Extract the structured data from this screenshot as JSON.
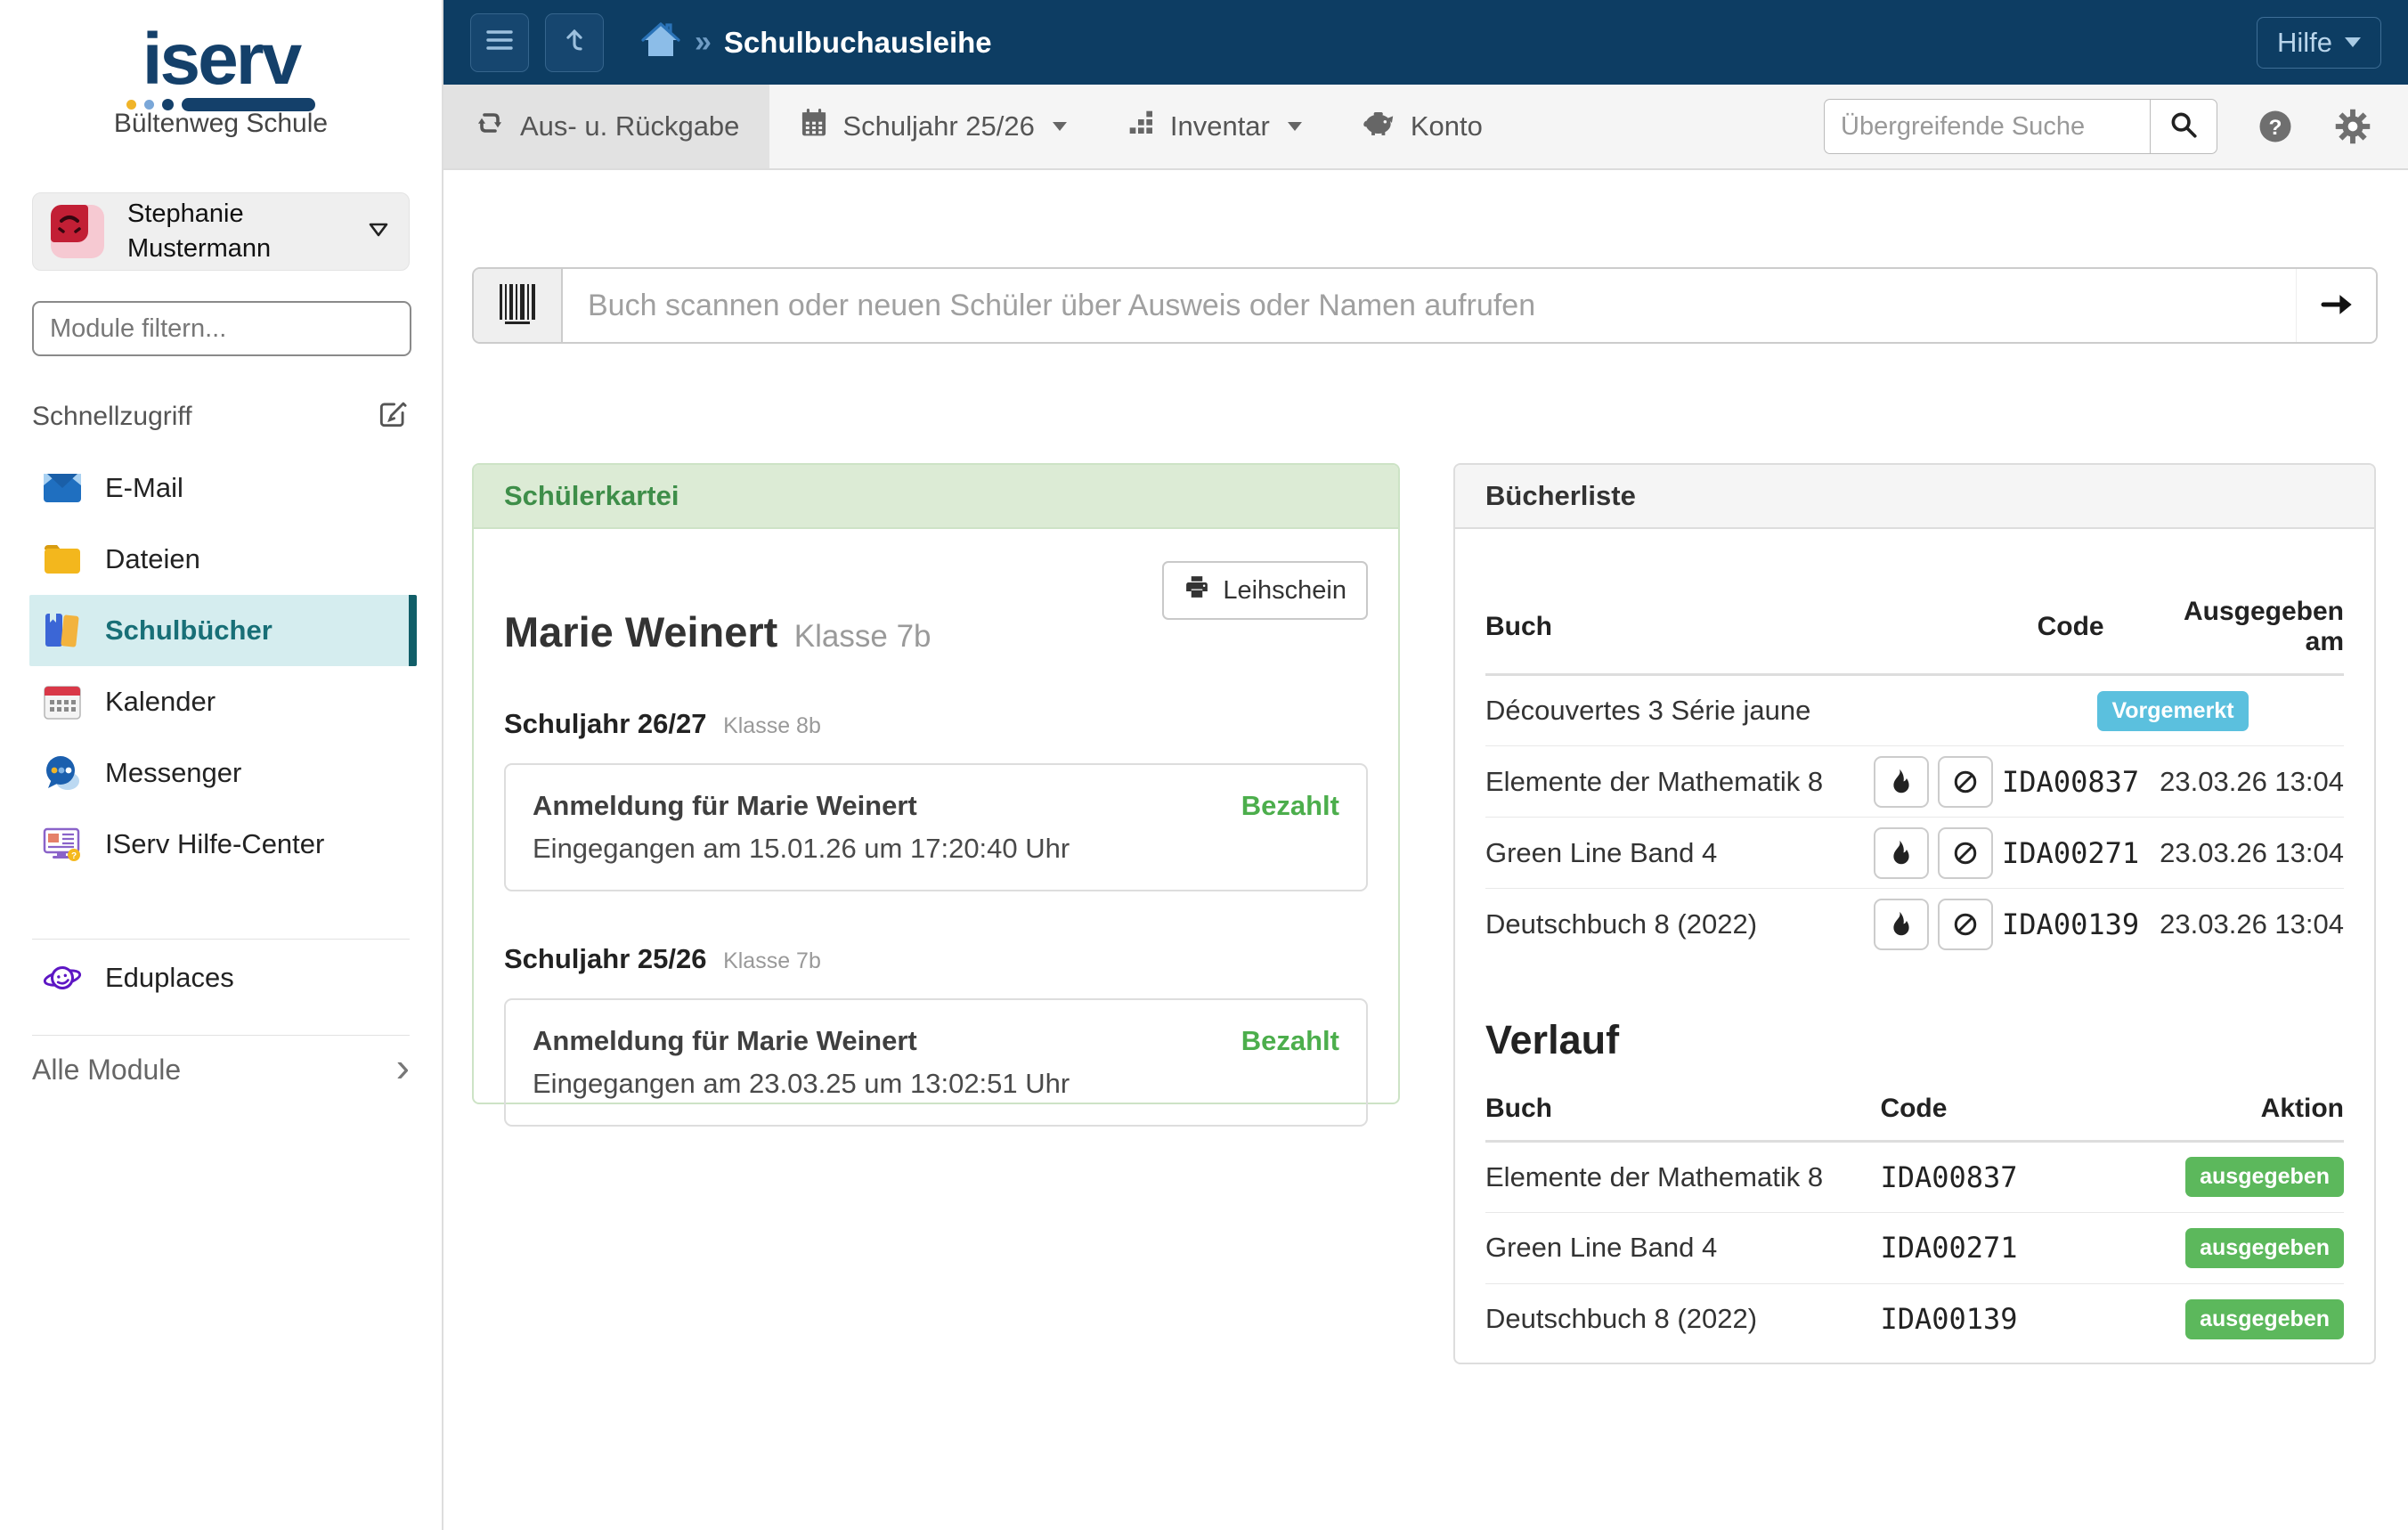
{
  "topbar": {
    "breadcrumb_sep": "»",
    "breadcrumb": "Schulbuchausleihe",
    "help_label": "Hilfe"
  },
  "module_nav": {
    "tabs": [
      {
        "label": "Aus- u. Rückgabe"
      },
      {
        "label": "Schuljahr 25/26"
      },
      {
        "label": "Inventar"
      },
      {
        "label": "Konto"
      }
    ],
    "search_placeholder": "Übergreifende Suche"
  },
  "sidebar": {
    "logo_text": "iserv",
    "school": "Bültenweg Schule",
    "user_name_line1": "Stephanie",
    "user_name_line2": "Mustermann",
    "filter_placeholder": "Module filtern...",
    "quick_access_label": "Schnellzugriff",
    "items": [
      {
        "label": "E-Mail"
      },
      {
        "label": "Dateien"
      },
      {
        "label": "Schulbücher"
      },
      {
        "label": "Kalender"
      },
      {
        "label": "Messenger"
      },
      {
        "label": "IServ Hilfe-Center"
      }
    ],
    "eduplaces_label": "Eduplaces",
    "all_modules_label": "Alle Module"
  },
  "scanbar": {
    "placeholder": "Buch scannen oder neuen Schüler über Ausweis oder Namen aufrufen"
  },
  "student_card": {
    "title": "Schülerkartei",
    "print_button": "Leihschein",
    "student_name": "Marie Weinert",
    "student_class": "Klasse 7b",
    "sections": [
      {
        "year": "Schuljahr 26/27",
        "class": "Klasse 8b",
        "entry_title": "Anmeldung für Marie Weinert",
        "entry_status": "Bezahlt",
        "entry_detail": "Eingegangen am 15.01.26 um 17:20:40 Uhr"
      },
      {
        "year": "Schuljahr 25/26",
        "class": "Klasse 7b",
        "entry_title": "Anmeldung für Marie Weinert",
        "entry_status": "Bezahlt",
        "entry_detail": "Eingegangen am 23.03.25 um 13:02:51 Uhr"
      }
    ]
  },
  "book_list": {
    "title": "Bücherliste",
    "columns": {
      "book": "Buch",
      "code": "Code",
      "issued": "Ausgegeben am"
    },
    "rows": [
      {
        "book": "Découvertes 3 Série jaune",
        "badge": "Vorgemerkt"
      },
      {
        "book": "Elemente der Mathematik 8",
        "code": "IDA00837",
        "issued": "23.03.26 13:04"
      },
      {
        "book": "Green Line Band 4",
        "code": "IDA00271",
        "issued": "23.03.26 13:04"
      },
      {
        "book": "Deutschbuch 8 (2022)",
        "code": "IDA00139",
        "issued": "23.03.26 13:04"
      }
    ]
  },
  "history": {
    "title": "Verlauf",
    "columns": {
      "book": "Buch",
      "code": "Code",
      "action": "Aktion"
    },
    "rows": [
      {
        "book": "Elemente der Mathematik 8",
        "code": "IDA00837",
        "action": "ausgegeben"
      },
      {
        "book": "Green Line Band 4",
        "code": "IDA00271",
        "action": "ausgegeben"
      },
      {
        "book": "Deutschbuch 8 (2022)",
        "code": "IDA00139",
        "action": "ausgegeben"
      }
    ]
  },
  "colors": {
    "topbar": "#0d3d63",
    "active_module_text": "#186f77",
    "active_module_bg": "#d5edef",
    "success_badge": "#5cb85c",
    "info_badge": "#5bc0de",
    "paid_text": "#4cae4c",
    "card_green_header": "#dcebd5"
  }
}
